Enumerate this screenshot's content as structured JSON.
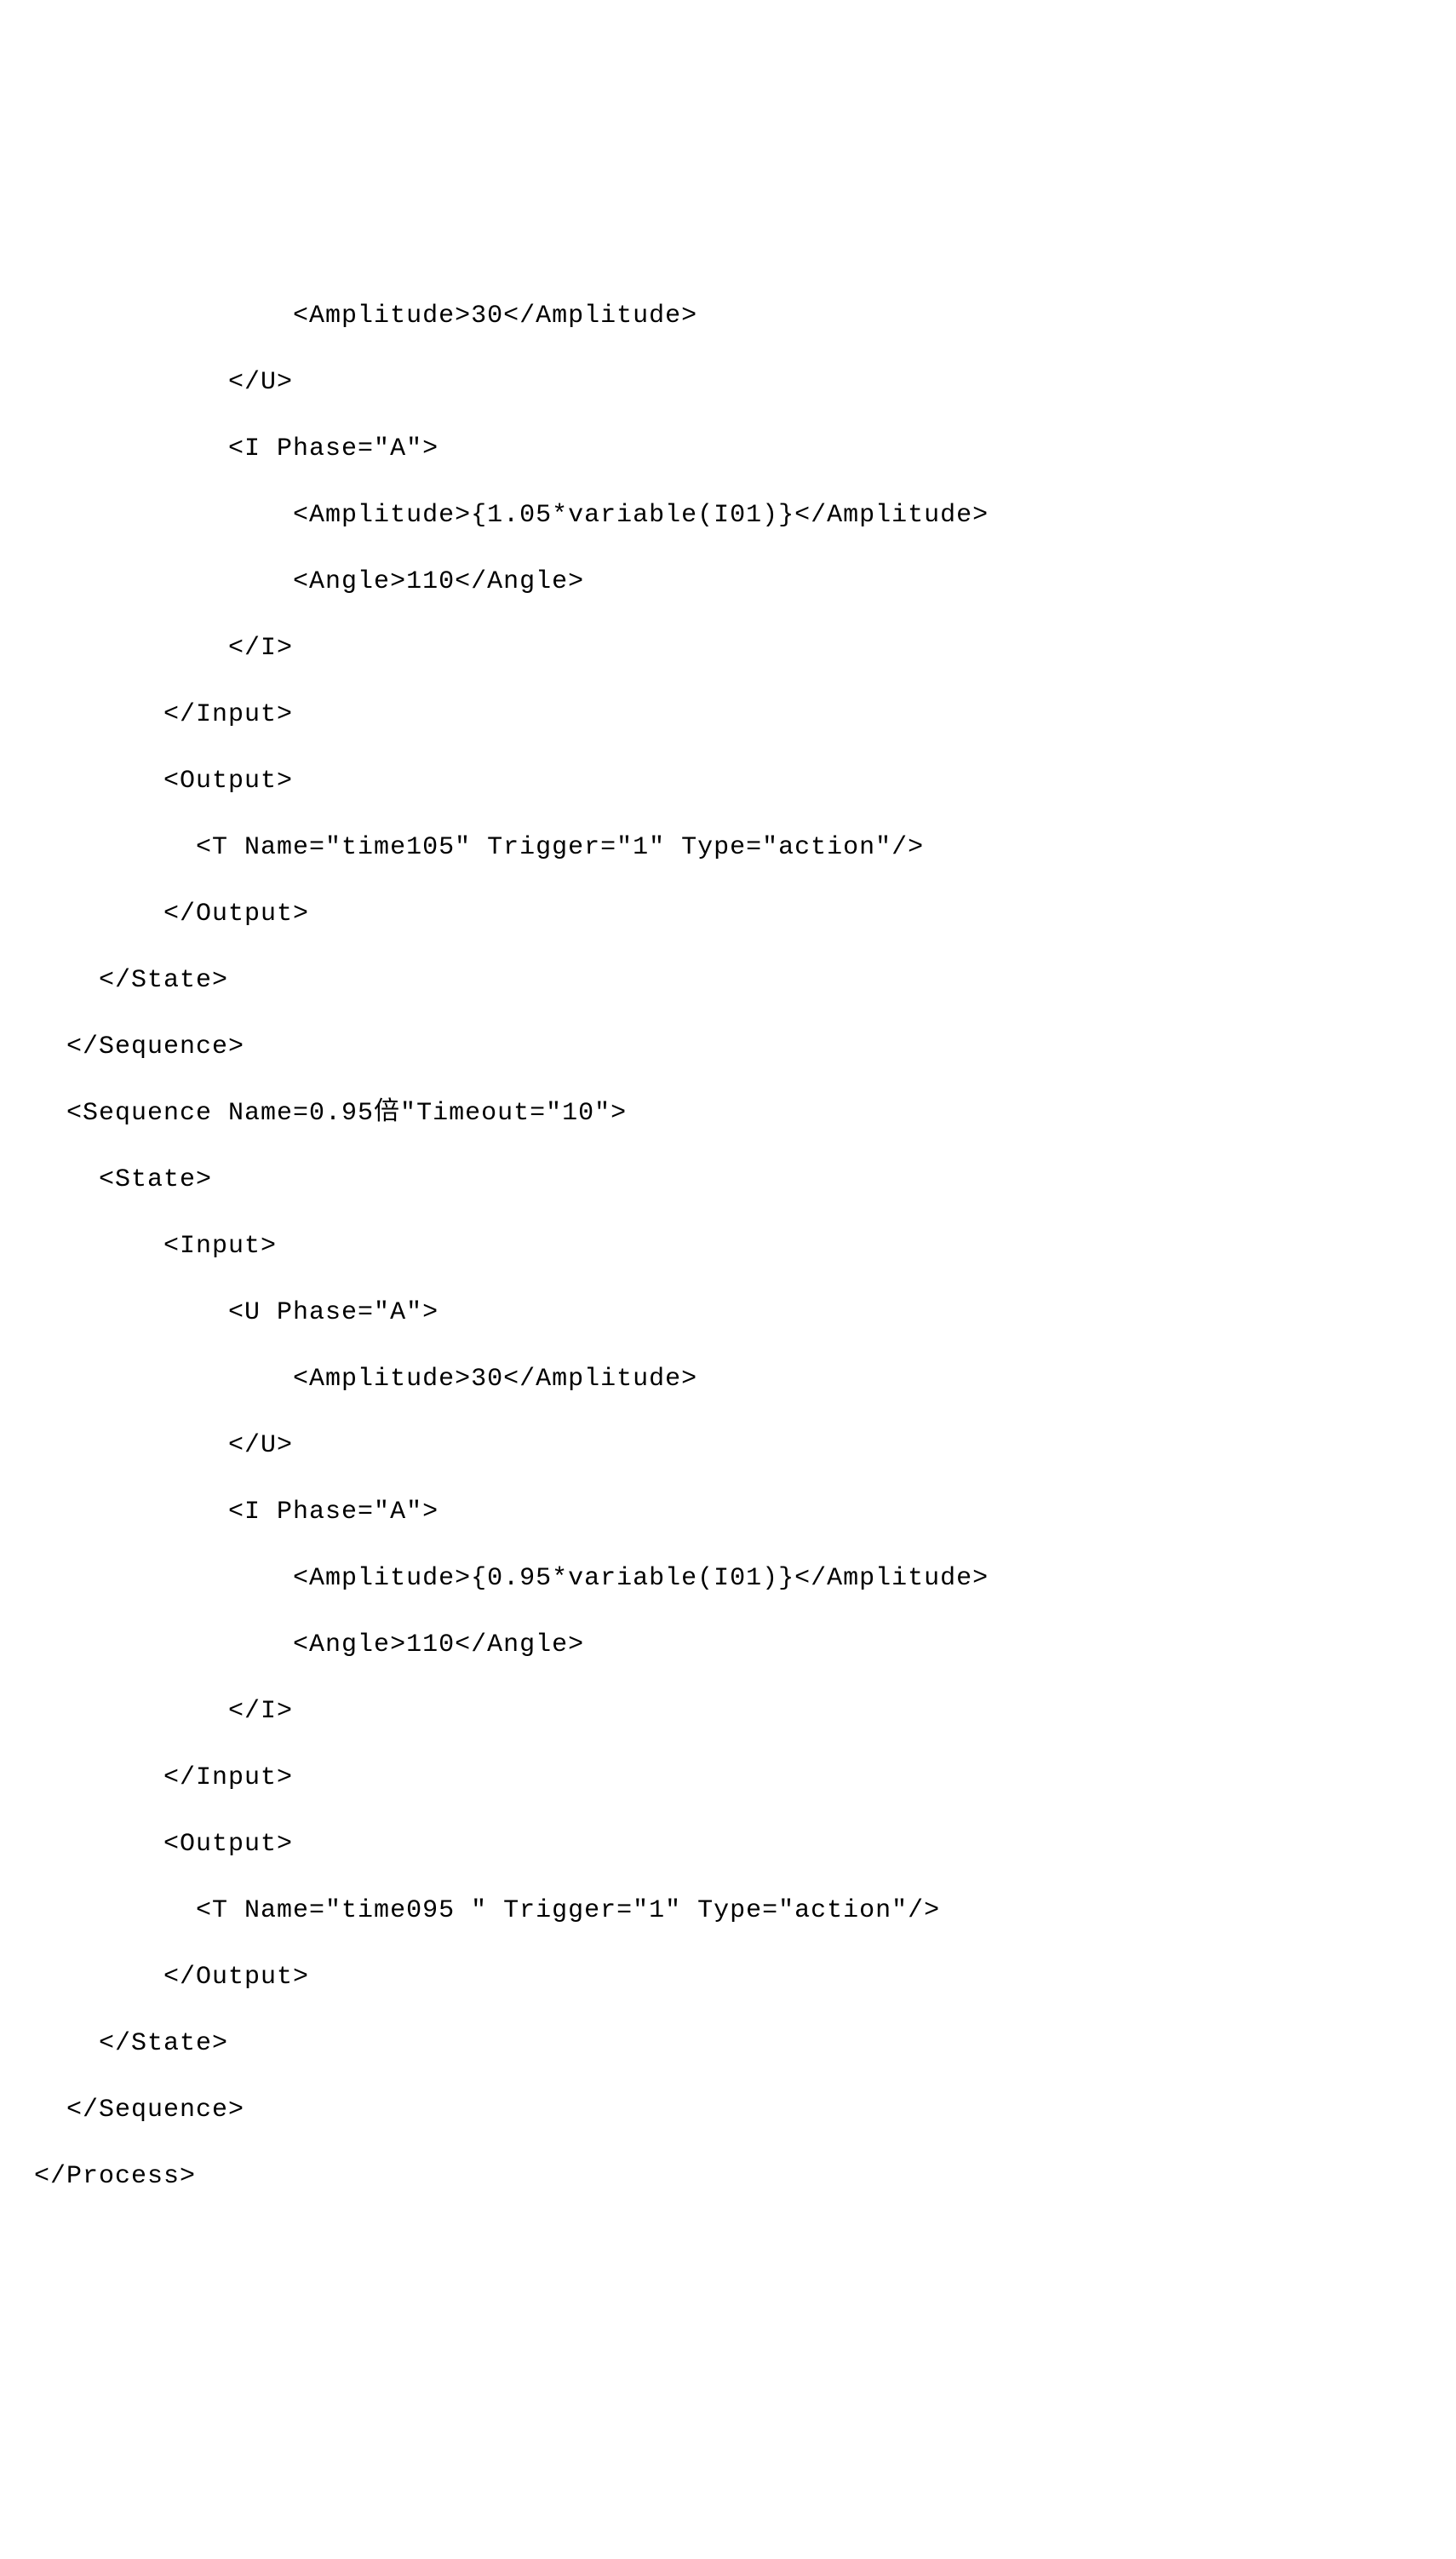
{
  "lines": [
    {
      "indent": 16,
      "text": "<Amplitude>30</Amplitude>"
    },
    {
      "indent": 12,
      "text": "</U>"
    },
    {
      "indent": 12,
      "text": "<I Phase=\"A\">"
    },
    {
      "indent": 16,
      "text": "<Amplitude>{1.05*variable(I01)}</Amplitude>"
    },
    {
      "indent": 16,
      "text": "<Angle>110</Angle>"
    },
    {
      "indent": 12,
      "text": "</I>"
    },
    {
      "indent": 8,
      "text": "</Input>"
    },
    {
      "indent": 8,
      "text": "<Output>"
    },
    {
      "indent": 10,
      "text": "<T Name=\"time105\" Trigger=\"1\" Type=\"action\"/>"
    },
    {
      "indent": 8,
      "text": "</Output>"
    },
    {
      "indent": 4,
      "text": "</State>"
    },
    {
      "indent": 2,
      "text": "</Sequence>"
    },
    {
      "indent": 2,
      "text": "<Sequence Name=0.95倍\"Timeout=\"10\">"
    },
    {
      "indent": 4,
      "text": "<State>"
    },
    {
      "indent": 8,
      "text": "<Input>"
    },
    {
      "indent": 12,
      "text": "<U Phase=\"A\">"
    },
    {
      "indent": 16,
      "text": "<Amplitude>30</Amplitude>"
    },
    {
      "indent": 12,
      "text": "</U>"
    },
    {
      "indent": 12,
      "text": "<I Phase=\"A\">"
    },
    {
      "indent": 16,
      "text": "<Amplitude>{0.95*variable(I01)}</Amplitude>"
    },
    {
      "indent": 16,
      "text": "<Angle>110</Angle>"
    },
    {
      "indent": 12,
      "text": "</I>"
    },
    {
      "indent": 8,
      "text": "</Input>"
    },
    {
      "indent": 8,
      "text": "<Output>"
    },
    {
      "indent": 10,
      "text": "<T Name=\"time095 \" Trigger=\"1\" Type=\"action\"/>"
    },
    {
      "indent": 8,
      "text": "</Output>"
    },
    {
      "indent": 4,
      "text": "</State>"
    },
    {
      "indent": 2,
      "text": "</Sequence>"
    },
    {
      "indent": 0,
      "text": "</Process>"
    }
  ]
}
